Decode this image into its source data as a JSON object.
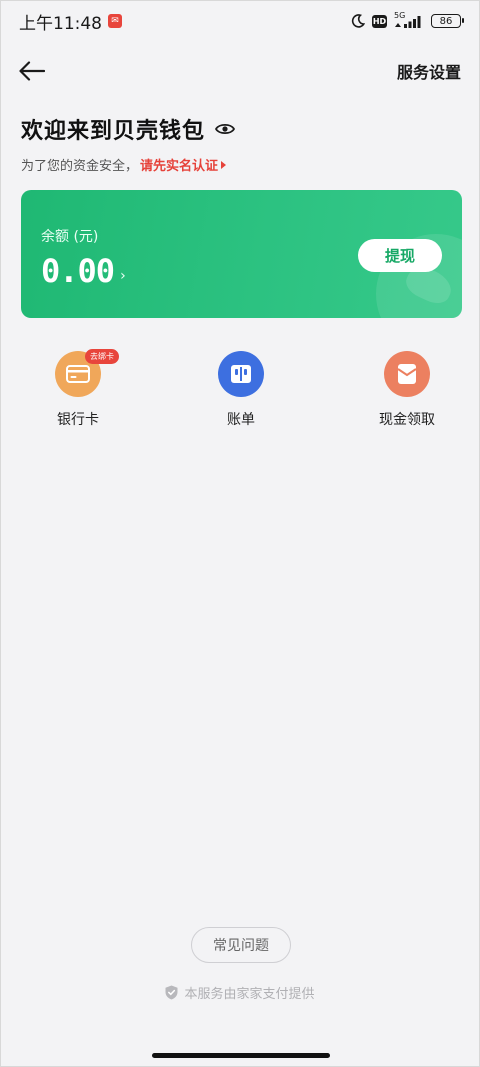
{
  "status_bar": {
    "time": "上午11:48",
    "network": "5G",
    "hd": "HD",
    "battery": "86"
  },
  "nav": {
    "service_settings": "服务设置"
  },
  "welcome": {
    "title": "欢迎来到贝壳钱包",
    "subtitle": "为了您的资金安全，",
    "verify_link": "请先实名认证"
  },
  "balance": {
    "label": "余额 (元)",
    "amount": "0.00",
    "withdraw": "提现"
  },
  "quick_actions": [
    {
      "label": "银行卡",
      "badge": "去绑卡",
      "color": "#f0a75a"
    },
    {
      "label": "账单",
      "color": "#3d6fe0"
    },
    {
      "label": "现金领取",
      "color": "#ec8060"
    }
  ],
  "footer": {
    "faq": "常见问题",
    "provider": "本服务由家家支付提供"
  },
  "colors": {
    "card_green": "#2cc281",
    "accent_red": "#e6423a",
    "withdraw_text": "#16a865"
  }
}
